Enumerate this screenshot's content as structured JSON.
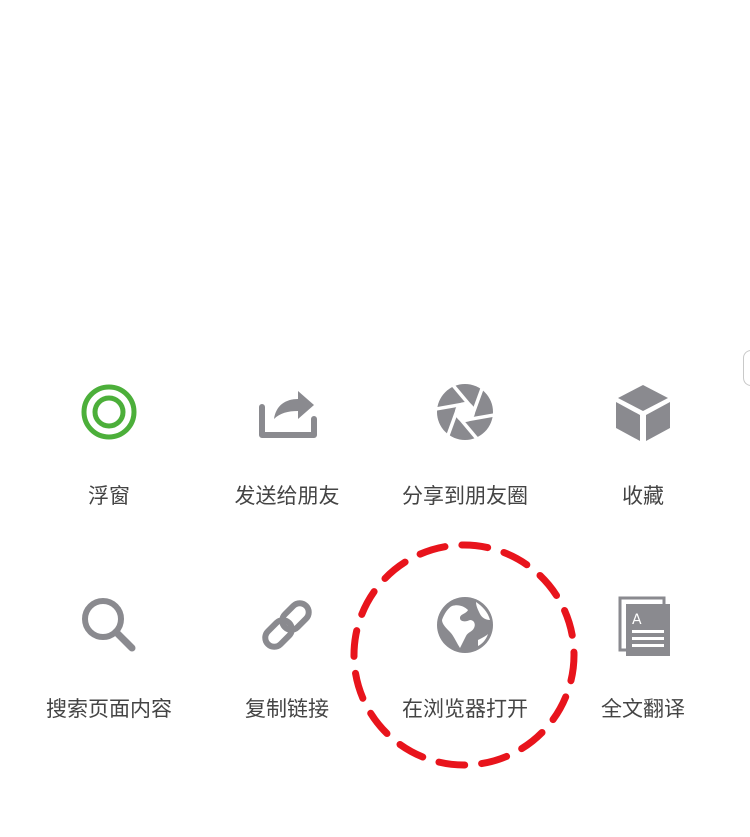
{
  "menu": {
    "items": [
      {
        "label": "浮窗",
        "icon": "floating-window-icon"
      },
      {
        "label": "发送给朋友",
        "icon": "share-arrow-icon"
      },
      {
        "label": "分享到朋友圈",
        "icon": "moments-shutter-icon"
      },
      {
        "label": "收藏",
        "icon": "cube-icon"
      },
      {
        "label": "搜索页面内容",
        "icon": "search-icon"
      },
      {
        "label": "复制链接",
        "icon": "link-icon"
      },
      {
        "label": "在浏览器打开",
        "icon": "globe-icon"
      },
      {
        "label": "全文翻译",
        "icon": "translate-document-icon"
      }
    ]
  },
  "colors": {
    "icon_gray": "#8a8a8f",
    "icon_green": "#4caf3a",
    "label_text": "#444444",
    "annotation_red": "#e8141c"
  },
  "annotation": {
    "highlighted_item": "在浏览器打开",
    "style": "red dashed circle"
  }
}
